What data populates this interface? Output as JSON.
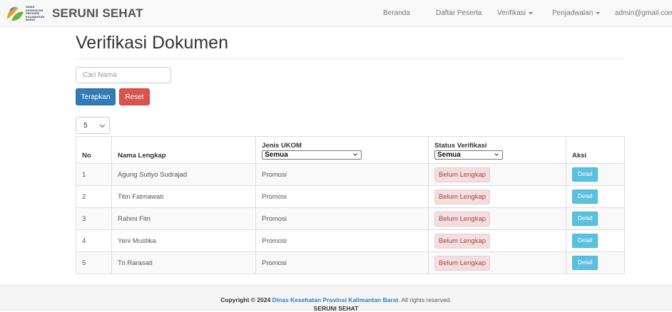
{
  "navbar": {
    "logo_text": [
      "DINAS",
      "KESEHATAN",
      "PROVINSI",
      "KALIMANTAN",
      "BARAT"
    ],
    "brand": "SERUNI SEHAT",
    "links": {
      "home": "Beranda",
      "participants": "Daftar Peserta",
      "verification": "Verifikasi",
      "scheduling": "Penjadwalan",
      "user": "admin@gmail.com"
    }
  },
  "page": {
    "title": "Verifikasi Dokumen",
    "search_placeholder": "Cari Nama",
    "apply_label": "Terapkan",
    "reset_label": "Reset",
    "page_size": "5"
  },
  "table": {
    "headers": {
      "no": "No",
      "name": "Nama Lengkap",
      "jenis": "Jenis UKOM",
      "status": "Status Verifikasi",
      "action": "Aksi"
    },
    "jenis_filter": "Semua",
    "status_filter": "Semua",
    "rows": [
      {
        "no": "1",
        "name": "Agung Sutiyo Sudrajad",
        "jenis": "Promosi",
        "status": "Belum Lengkap",
        "action": "Detail"
      },
      {
        "no": "2",
        "name": "Titin Fatmawati",
        "jenis": "Promosi",
        "status": "Belum Lengkap",
        "action": "Detail"
      },
      {
        "no": "3",
        "name": "Rahmi Fitri",
        "jenis": "Promosi",
        "status": "Belum Lengkap",
        "action": "Detail"
      },
      {
        "no": "4",
        "name": "Yeni Mustika",
        "jenis": "Promosi",
        "status": "Belum Lengkap",
        "action": "Detail"
      },
      {
        "no": "5",
        "name": "Tri Rarasati",
        "jenis": "Promosi",
        "status": "Belum Lengkap",
        "action": "Detail"
      }
    ]
  },
  "footer": {
    "copyright_prefix": "Copyright © 2024",
    "org_link": "Dinas Kesehatan Provinsi Kalimantan Barat",
    "suffix": ". All rights reserved.",
    "brand": "SERUNI SEHAT"
  },
  "colors": {
    "primary": "#337ab7",
    "danger": "#d9534f",
    "info": "#5bc0de",
    "badge_bg": "#f2dede",
    "badge_text": "#a94442",
    "logo_orange": "#f39a1d",
    "logo_green": "#6db33f"
  }
}
